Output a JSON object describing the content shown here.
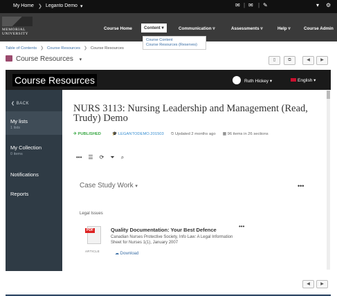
{
  "topbar": {
    "home": "My Home",
    "course": "Leganto Demo",
    "icons": [
      "mail-icon",
      "message-icon",
      "chat-icon",
      "user-icon",
      "gear-icon"
    ]
  },
  "header": {
    "logo": "MEMORIAL UNIVERSITY",
    "nav": [
      "Course Home",
      "Content",
      "Communication",
      "Assessments",
      "Help",
      "Course Admin"
    ],
    "dropdown": [
      "Course Content",
      "Course Resources (Reserves)"
    ]
  },
  "breadcrumb": [
    "Table of Contents",
    "Course Resources",
    "Course Resources"
  ],
  "page_title": "Course Resources",
  "frame": {
    "title": "Course Resources",
    "user": "Ruth Hickey",
    "language": "English"
  },
  "sidebar": {
    "back": "BACK",
    "items": [
      {
        "label": "My lists",
        "sub": "1 lists"
      },
      {
        "label": "My Collection",
        "sub": "0 items"
      },
      {
        "label": "Notifications",
        "sub": ""
      },
      {
        "label": "Reports",
        "sub": ""
      }
    ]
  },
  "list": {
    "title": "NURS 3113: Nursing Leadership and Management (Read, Trudy) Demo",
    "status": "PUBLISHED",
    "code": "LEGANTODEMO.201503",
    "updated": "Updated 2 months ago",
    "count": "96 items in 26 sections",
    "section": "Case Study Work",
    "subsection": "Legal Issues"
  },
  "citation": {
    "type": "ARTICLE",
    "title": "Quality Documentation: Your Best Defence",
    "description": "Canadian Nurses Protective Society, Info Law: A Legal Information Sheet for Nurses 1(1), January 2007",
    "download": "Download"
  }
}
